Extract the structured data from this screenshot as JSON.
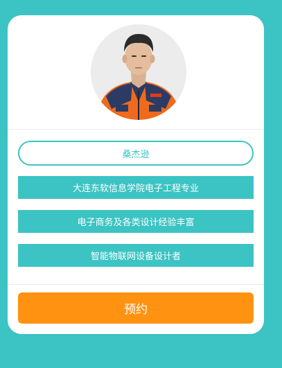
{
  "profile": {
    "name": "桑杰逊",
    "tags": [
      "大连东软信息学院电子工程专业",
      "电子商务及各类设计经验丰富",
      "智能物联网设备设计者"
    ]
  },
  "actions": {
    "book_label": "预约"
  },
  "colors": {
    "accent": "#3cc3c3",
    "button": "#ff9211",
    "card": "#ffffff"
  }
}
